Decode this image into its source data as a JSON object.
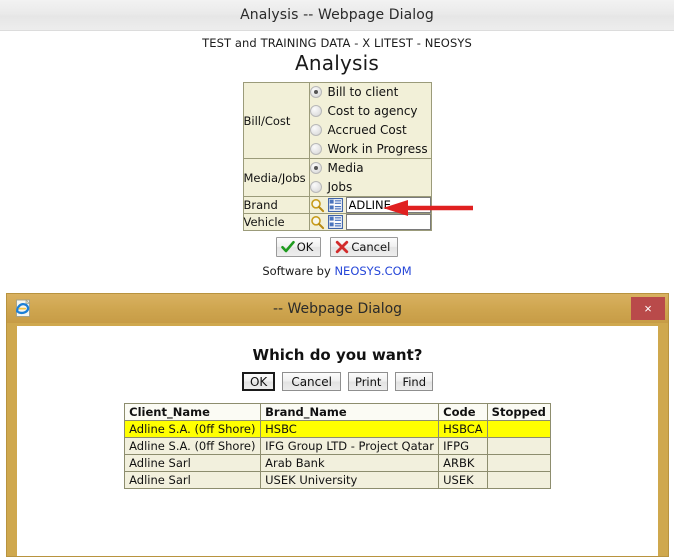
{
  "outer_window": {
    "title": "Analysis -- Webpage Dialog",
    "subtitle": "TEST and TRAINING DATA - X  LITEST - NEOSYS",
    "heading": "Analysis",
    "form": {
      "rows": [
        {
          "label": "Bill/Cost",
          "type": "radio",
          "options": [
            {
              "label": "Bill to client",
              "selected": true
            },
            {
              "label": "Cost to agency",
              "selected": false
            },
            {
              "label": "Accrued Cost",
              "selected": false
            },
            {
              "label": "Work in Progress",
              "selected": false
            }
          ]
        },
        {
          "label": "Media/Jobs",
          "type": "radio",
          "options": [
            {
              "label": "Media",
              "selected": true
            },
            {
              "label": "Jobs",
              "selected": false
            }
          ]
        },
        {
          "label": "Brand",
          "type": "lookup",
          "value": "ADLINE",
          "search_icon": "magnifier-icon",
          "list_icon": "list-lookup-icon"
        },
        {
          "label": "Vehicle",
          "type": "lookup",
          "value": "",
          "search_icon": "magnifier-icon",
          "list_icon": "list-lookup-icon"
        }
      ]
    },
    "buttons": {
      "ok": "OK",
      "cancel": "Cancel",
      "ok_icon": "green-check-icon",
      "cancel_icon": "red-cross-icon"
    },
    "footer": {
      "prefix": "Software by",
      "link": "NEOSYS.COM"
    },
    "annotation": {
      "type": "red-arrow",
      "points_to": "brand-value-input",
      "color": "#e02020"
    }
  },
  "inner_window": {
    "title": "-- Webpage Dialog",
    "icon": "internet-explorer-icon",
    "close_label": "×",
    "titlebar_color": "#cfa650",
    "close_color": "#b94a4a",
    "heading": "Which do you want?",
    "buttons": [
      {
        "label": "OK",
        "focused": true
      },
      {
        "label": "Cancel",
        "focused": false
      },
      {
        "label": "Print",
        "focused": false
      },
      {
        "label": "Find",
        "focused": false
      }
    ],
    "grid": {
      "columns": [
        "Client_Name",
        "Brand_Name",
        "Code",
        "Stopped"
      ],
      "rows": [
        {
          "selected": true,
          "cells": [
            "Adline S.A. (0ff Shore)",
            "HSBC",
            "HSBCA",
            ""
          ]
        },
        {
          "selected": false,
          "cells": [
            "Adline S.A. (0ff Shore)",
            "IFG Group LTD - Project Qatar",
            "IFPG",
            ""
          ]
        },
        {
          "selected": false,
          "cells": [
            "Adline Sarl",
            "Arab Bank",
            "ARBK",
            ""
          ]
        },
        {
          "selected": false,
          "cells": [
            "Adline Sarl",
            "USEK University",
            "USEK",
            ""
          ]
        }
      ],
      "selected_row_color": "#ffff00",
      "body_color": "#f2f0dd"
    }
  }
}
